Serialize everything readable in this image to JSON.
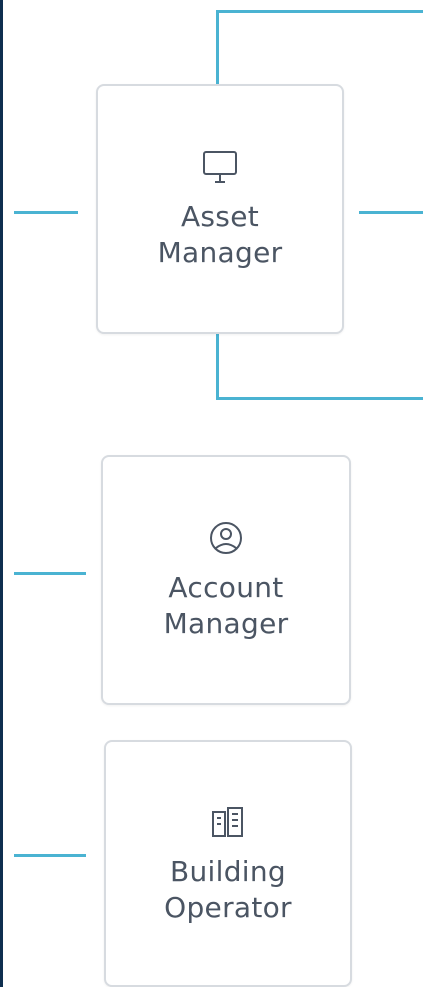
{
  "colors": {
    "connector": "#4ab3d2",
    "card_border": "#d7dbe0",
    "card_text": "#4b5563",
    "left_rail": "#0f2f4f"
  },
  "cards": [
    {
      "label": "Asset\nManager",
      "icon": "monitor-icon"
    },
    {
      "label": "Account\nManager",
      "icon": "user-circle-icon"
    },
    {
      "label": "Building\nOperator",
      "icon": "building-icon"
    }
  ]
}
